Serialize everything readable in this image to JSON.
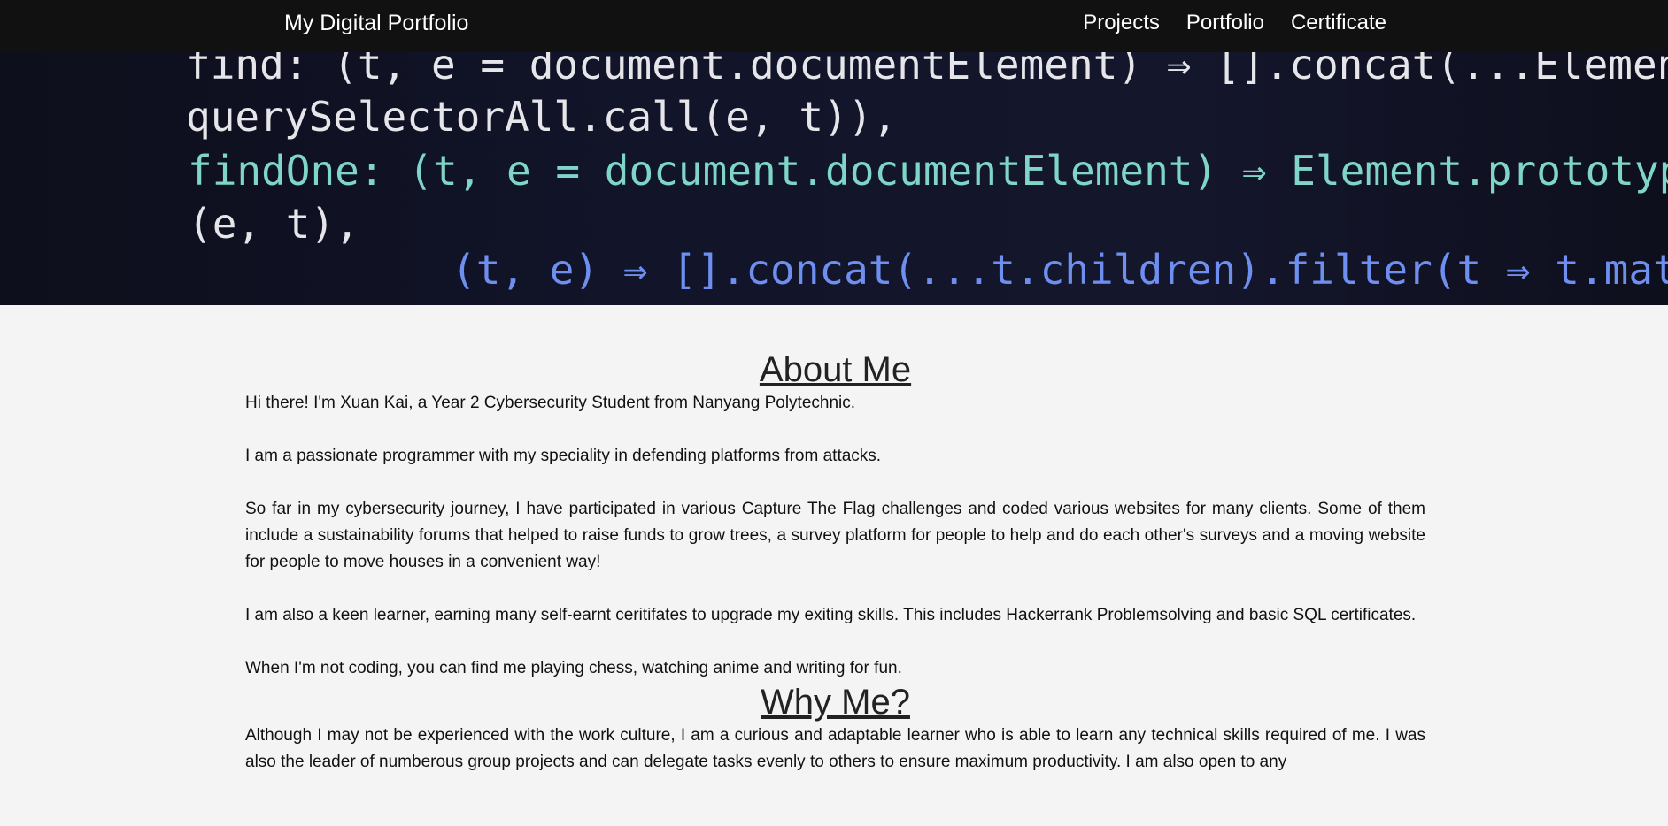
{
  "navbar": {
    "brand": "My Digital Portfolio",
    "links": [
      "Projects",
      "Portfolio",
      "Certificate"
    ]
  },
  "hero": {
    "code_lines": [
      "find: (t, e = document.documentElement) ⇒ [].concat(...Element.pro",
      "querySelectorAll.call(e, t)),",
      "findOne: (t, e = document.documentElement) ⇒ Element.prototype.que",
      "(e, t),",
      "(t, e) ⇒ [].concat(...t.children).filter(t ⇒ t.matches("
    ]
  },
  "about": {
    "title": "About Me",
    "paragraphs": [
      "Hi there! I'm Xuan Kai, a Year 2 Cybersecurity Student from Nanyang Polytechnic.",
      "I am a passionate programmer with my speciality in defending platforms from attacks.",
      "So far in my cybersecurity journey, I have participated in various Capture The Flag challenges and coded various websites for many clients. Some of them include a sustainability forums that helped to raise funds to grow trees, a survey platform for people to help and do each other's surveys and a moving website for people to move houses in a convenient way!",
      "I am also a keen learner, earning many self-earnt ceritifates to upgrade my exiting skills. This includes Hackerrank Problemsolving and basic SQL certificates.",
      "When I'm not coding, you can find me playing chess, watching anime and writing for fun."
    ]
  },
  "why": {
    "title": "Why Me?",
    "paragraph": "Although I may not be experienced with the work culture, I am a curious and adaptable learner who is able to learn any technical skills required of me. I was also the leader of numberous group projects and can delegate tasks evenly to others to ensure maximum productivity. I am also open to any"
  },
  "colors": {
    "navbar_bg": "#111111",
    "page_bg": "#f4f4f4",
    "code_white": "#e6e6ea",
    "code_teal": "#7fd6c8",
    "code_blue": "#6f8ff0",
    "code_orange": "#e8a56b",
    "code_purple": "#a678e0"
  }
}
